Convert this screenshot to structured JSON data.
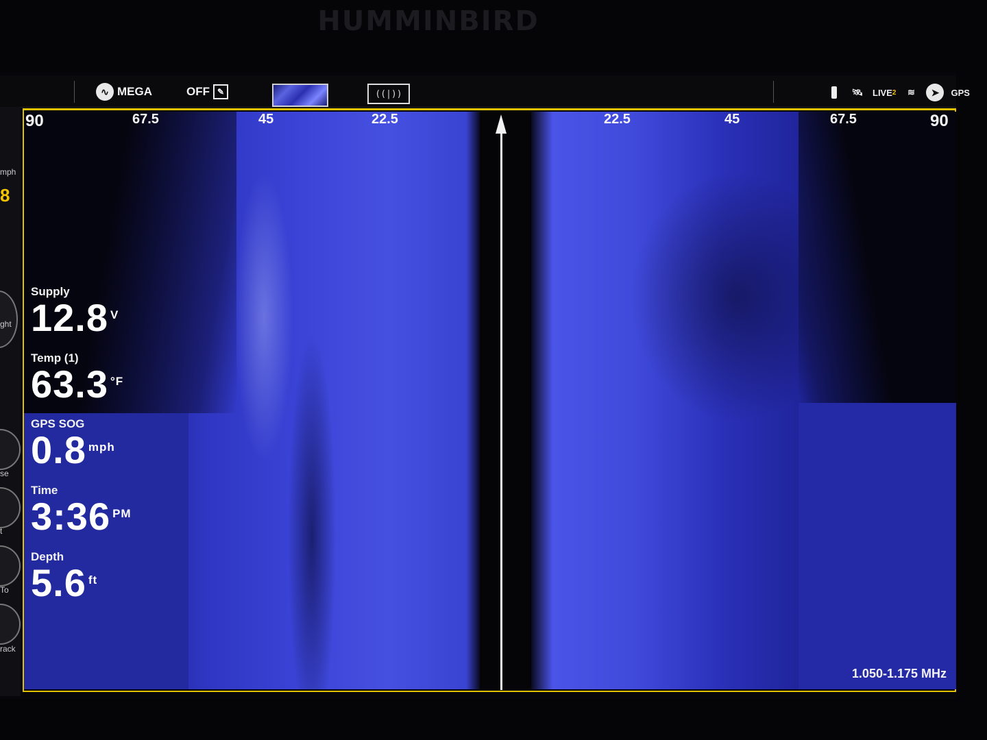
{
  "bezel": {
    "brand": "HUMMINBIRD"
  },
  "topbar": {
    "mega_label": "MEGA",
    "off_label": "OFF",
    "live_label": "LIVE",
    "live_badge": "2",
    "gps_label": "GPS"
  },
  "left_strip": {
    "unit_partial": "mph",
    "value_partial": "8",
    "labels": [
      "ght",
      "se",
      "t",
      "To",
      "rack"
    ]
  },
  "sonar": {
    "left_scale": [
      "90",
      "67.5",
      "45",
      "22.5"
    ],
    "right_scale": [
      "22.5",
      "45",
      "67.5",
      "90"
    ],
    "frequency": "1.050-1.175 MHz"
  },
  "readouts": [
    {
      "label": "Supply",
      "value": "12.8",
      "unit": "V"
    },
    {
      "label": "Temp (1)",
      "value": "63.3",
      "unit": "°F"
    },
    {
      "label": "GPS SOG",
      "value": "0.8",
      "unit": "mph"
    },
    {
      "label": "Time",
      "value": "3:36",
      "unit": "PM"
    },
    {
      "label": "Depth",
      "value": "5.6",
      "unit": "ft"
    }
  ],
  "colors": {
    "accent_frame": "#e1c200",
    "sonar_blue": "#3a43d6"
  }
}
